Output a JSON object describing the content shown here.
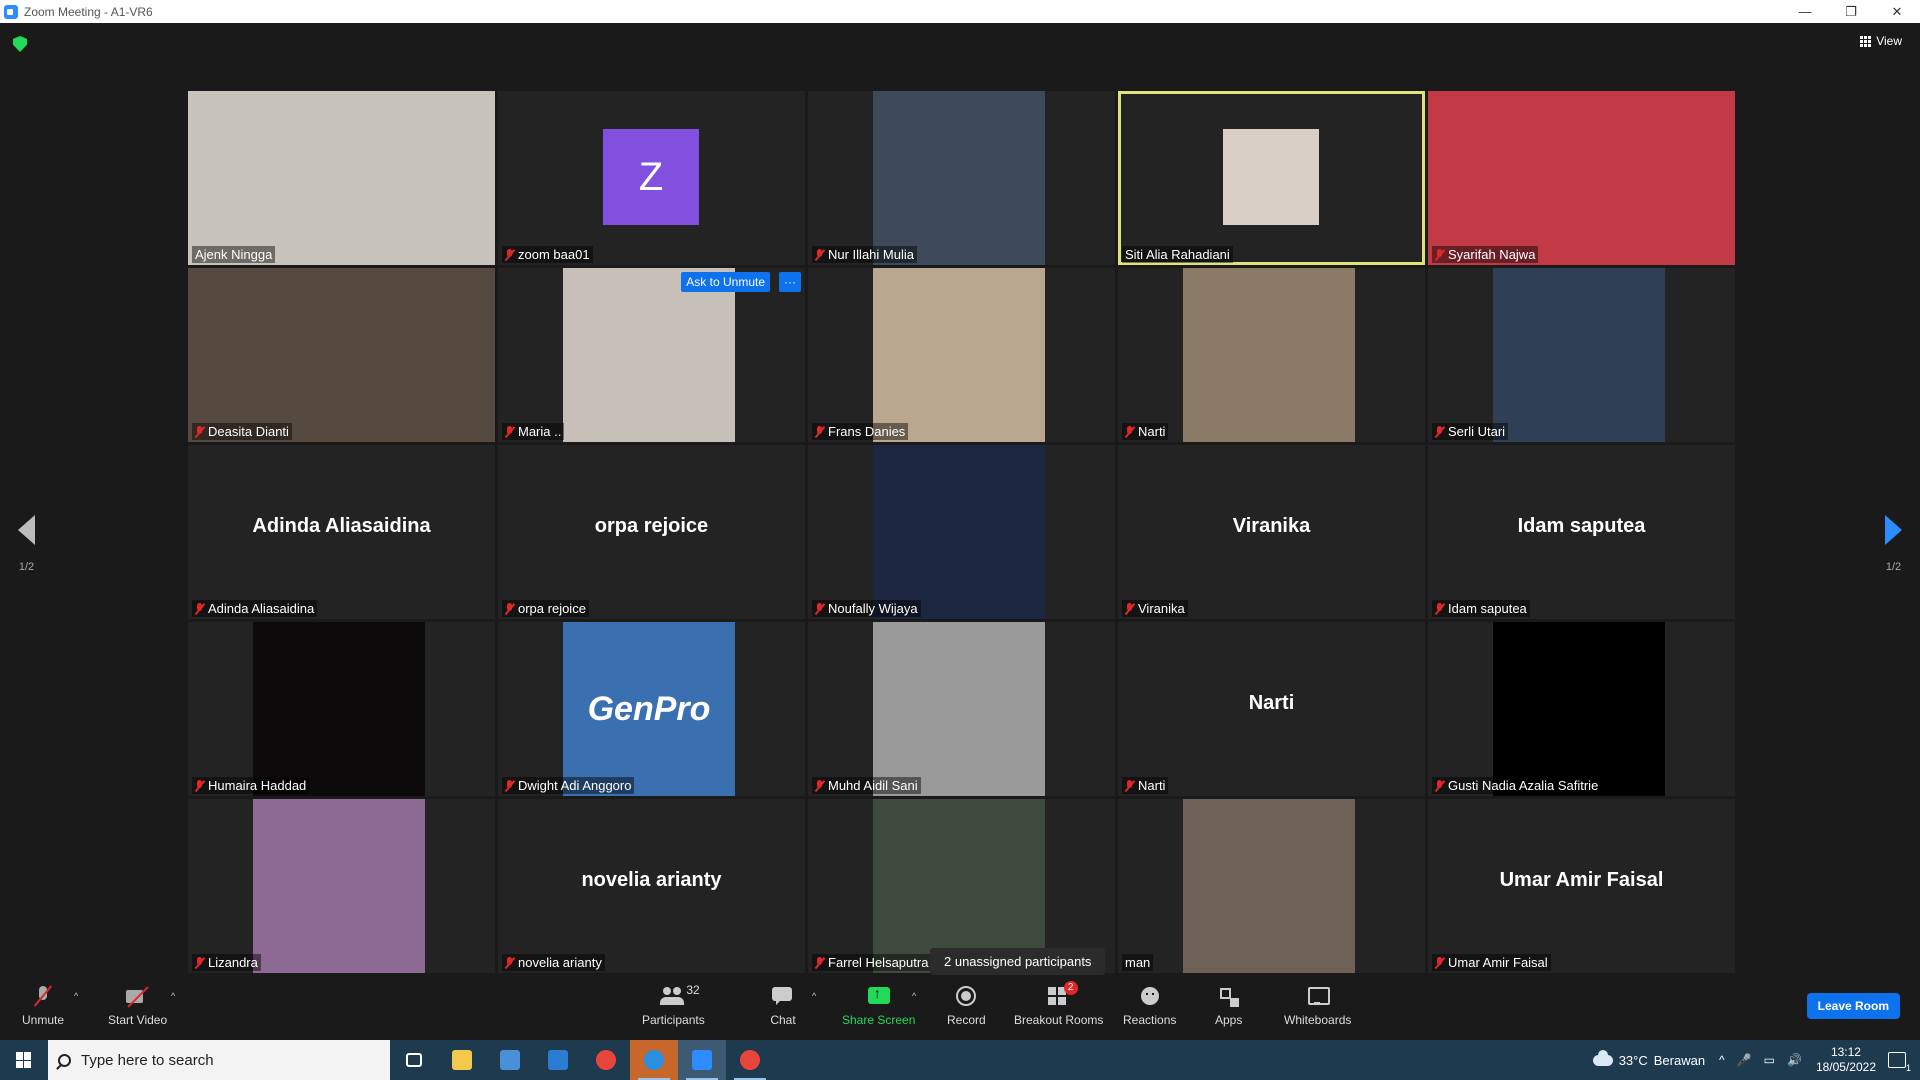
{
  "window": {
    "title": "Zoom Meeting - A1-VR6",
    "minimize": "—",
    "restore": "❐",
    "close": "✕"
  },
  "header": {
    "view_label": "View"
  },
  "pagination": {
    "left_page": "1/2",
    "right_page": "1/2"
  },
  "colors": {
    "active_speaker_border": "#dfe37a",
    "muted_icon": "#e02828",
    "accent_blue": "#0e72ed",
    "share_green": "#23d959",
    "avatar_purple": "#8250df"
  },
  "tiles": [
    {
      "name": "Ajenk Ningga",
      "muted": false,
      "kind": "video",
      "frame": "full",
      "color": "#c8c4bc"
    },
    {
      "name": "zoom baa01",
      "muted": true,
      "kind": "avatar",
      "letter": "Z"
    },
    {
      "name": "Nur Illahi Mulia",
      "muted": true,
      "kind": "video",
      "frame": "mid",
      "color": "#3e4a5a"
    },
    {
      "name": "Siti Alia Rahadiani",
      "muted": false,
      "kind": "photo",
      "active": true,
      "color": "#d9cfc7"
    },
    {
      "name": "Syarifah Najwa",
      "muted": true,
      "kind": "video",
      "frame": "full",
      "color": "#c23a46"
    },
    {
      "name": "Deasita Dianti",
      "muted": true,
      "kind": "video",
      "frame": "full",
      "color": "#564a40"
    },
    {
      "name": "Maria ..",
      "muted": true,
      "kind": "video",
      "frame": "mid",
      "color": "#c7c0b8",
      "ask_to_unmute": "Ask to Unmute",
      "more": "···"
    },
    {
      "name": "Frans Danies",
      "muted": true,
      "kind": "video",
      "frame": "mid",
      "color": "#b9a88f"
    },
    {
      "name": "Narti",
      "muted": true,
      "kind": "video",
      "frame": "mid",
      "color": "#8a7a66"
    },
    {
      "name": "Serli Utari",
      "muted": true,
      "kind": "video",
      "frame": "mid",
      "color": "#2f3f55"
    },
    {
      "name": "Adinda Aliasaidina",
      "muted": true,
      "kind": "name"
    },
    {
      "name": "orpa rejoice",
      "muted": true,
      "kind": "name"
    },
    {
      "name": "Noufally Wijaya",
      "muted": true,
      "kind": "video",
      "frame": "mid",
      "color": "#1c2640"
    },
    {
      "name": "Viranika",
      "muted": true,
      "kind": "name"
    },
    {
      "name": "Idam saputea",
      "muted": true,
      "kind": "name"
    },
    {
      "name": "Humaira Haddad",
      "muted": true,
      "kind": "video",
      "frame": "mid",
      "color": "#0d0a0c"
    },
    {
      "name": "Dwight Adi Anggoro",
      "muted": true,
      "kind": "logo",
      "logo_text": "GenPro",
      "color": "#3a6fb0"
    },
    {
      "name": "Muhd Aidil Sani",
      "muted": true,
      "kind": "video",
      "frame": "mid",
      "color": "#9a9a9a"
    },
    {
      "name": "Narti",
      "muted": true,
      "kind": "name"
    },
    {
      "name": "Gusti Nadia Azalia Safitrie",
      "muted": true,
      "kind": "video",
      "frame": "mid",
      "color": "#000000"
    },
    {
      "name": "Lizandra",
      "muted": true,
      "kind": "video",
      "frame": "mid",
      "color": "#8d6a94"
    },
    {
      "name": "novelia arianty",
      "muted": true,
      "kind": "name"
    },
    {
      "name": "Farrel Helsaputra",
      "muted": true,
      "kind": "video",
      "frame": "mid",
      "color": "#3f4a3e"
    },
    {
      "name": "man",
      "muted": false,
      "kind": "video",
      "frame": "mid",
      "color": "#6e6258"
    },
    {
      "name": "Umar Amir Faisal",
      "muted": true,
      "kind": "name"
    }
  ],
  "tooltip": {
    "text": "2 unassigned participants"
  },
  "toolbar": {
    "unmute": "Unmute",
    "start_video": "Start Video",
    "participants": "Participants",
    "participants_count": "32",
    "chat": "Chat",
    "share_screen": "Share Screen",
    "record": "Record",
    "breakout_rooms": "Breakout Rooms",
    "breakout_badge": "2",
    "reactions": "Reactions",
    "apps": "Apps",
    "whiteboards": "Whiteboards",
    "leave_room": "Leave Room",
    "caret": "^"
  },
  "taskbar": {
    "search_placeholder": "Type here to search",
    "weather_temp": "33°C",
    "weather_desc": "Berawan",
    "time": "13:12",
    "date": "18/05/2022",
    "notifications": "1",
    "tray_icons": [
      "^",
      "🎤",
      "▭",
      "🔊"
    ]
  }
}
